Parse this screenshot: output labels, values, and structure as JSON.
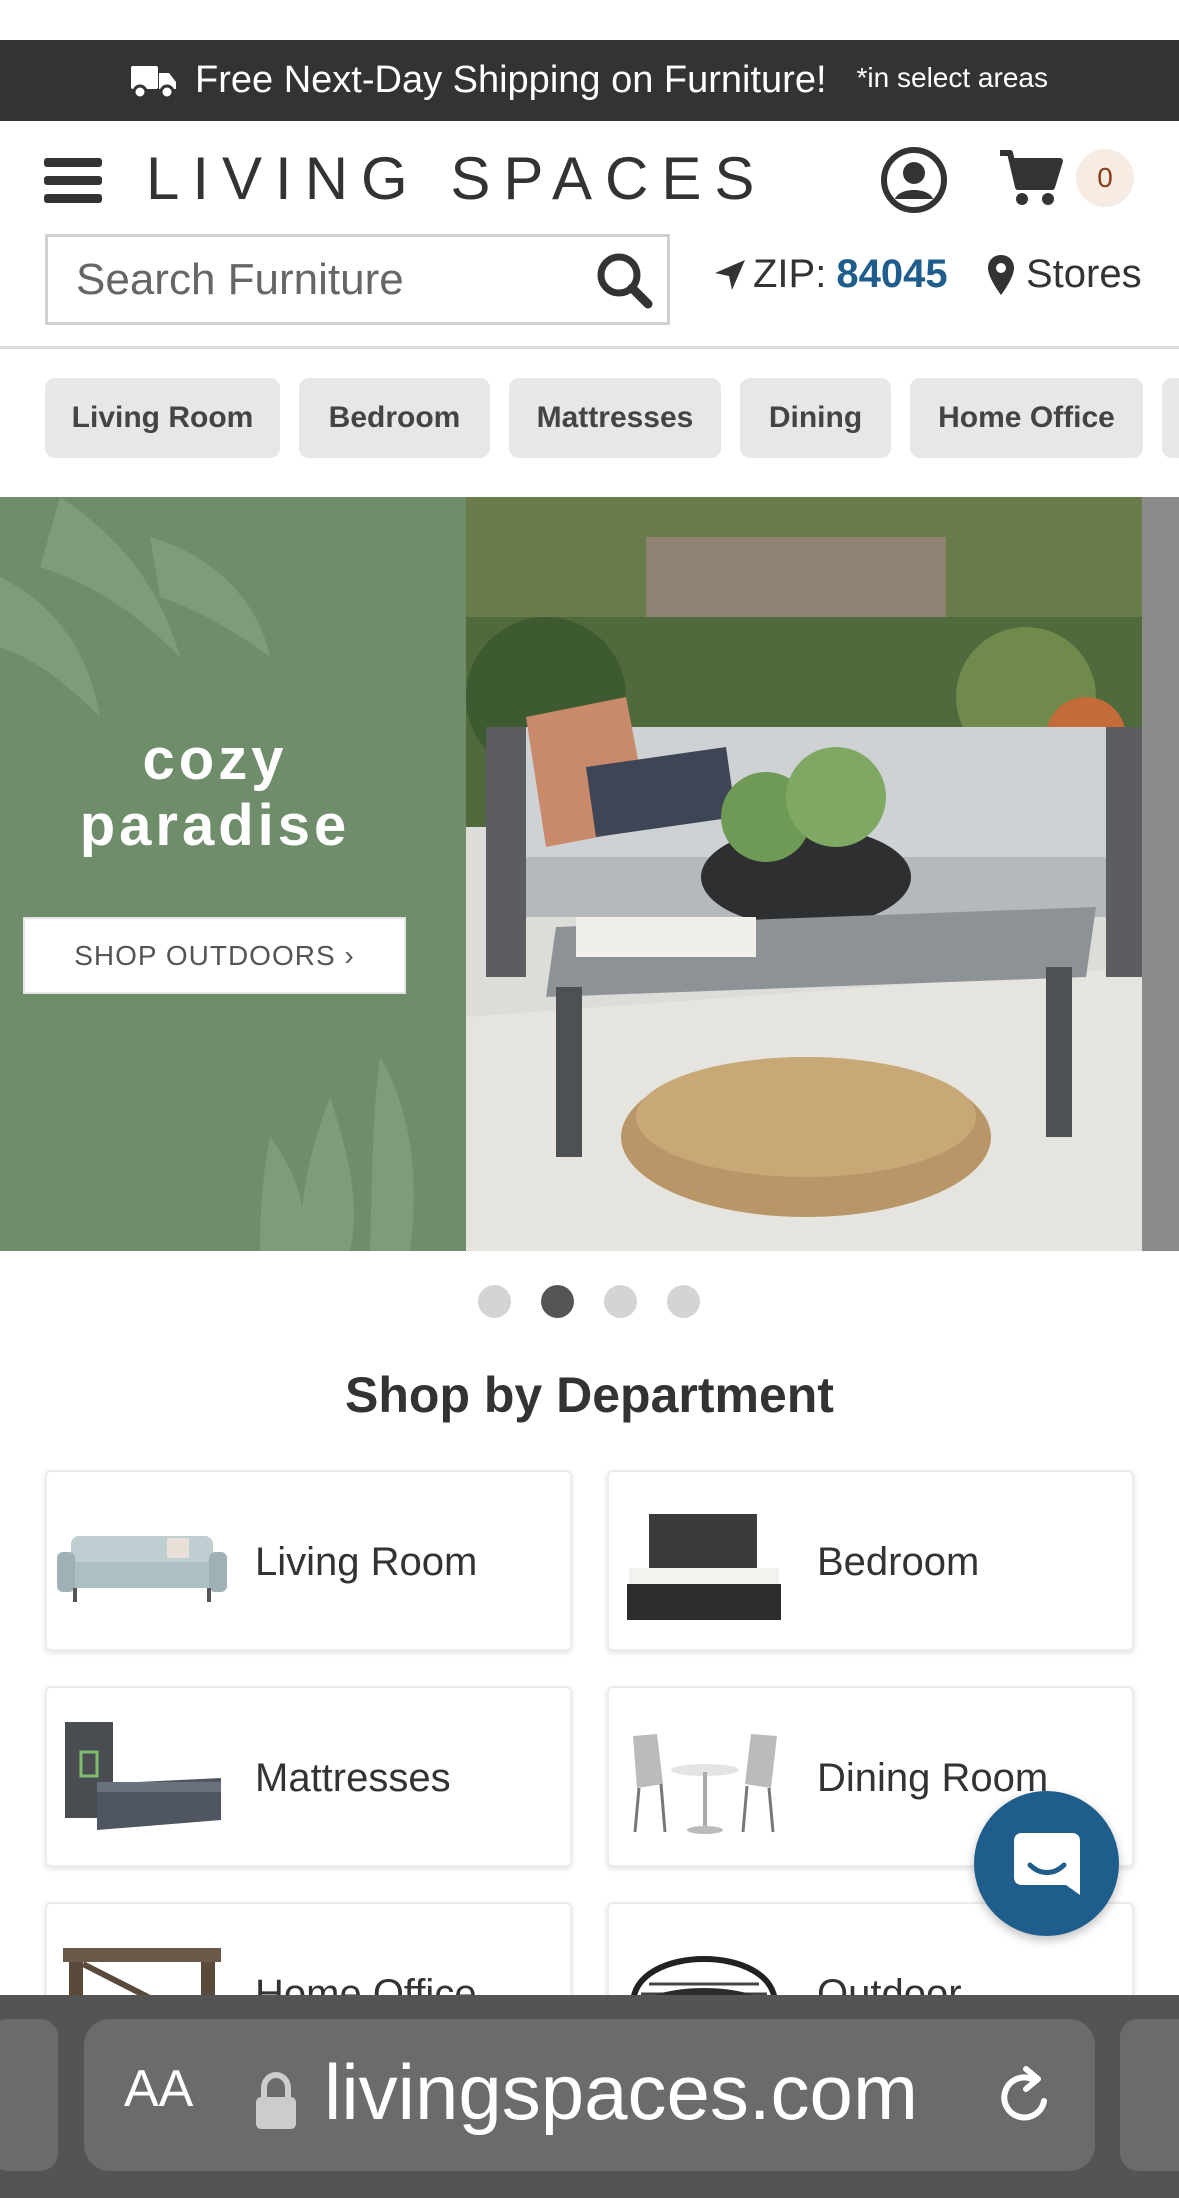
{
  "banner": {
    "main_text": "Free Next-Day Shipping on Furniture!",
    "note_text": "*in select areas"
  },
  "header": {
    "logo": "LIVING SPACES",
    "cart_count": "0",
    "search_placeholder": "Search Furniture",
    "zip_label": "ZIP:",
    "zip_code": "84045",
    "stores_label": "Stores"
  },
  "categories": [
    "Living Room",
    "Bedroom",
    "Mattresses",
    "Dining",
    "Home Office"
  ],
  "hero": {
    "title_line1": "cozy",
    "title_line2": "paradise",
    "cta_label": "SHOP OUTDOORS ›",
    "slide_count": 4,
    "active_slide": 2,
    "background_color": "#6f8c6b"
  },
  "departments": {
    "title": "Shop by Department",
    "items": [
      "Living Room",
      "Bedroom",
      "Mattresses",
      "Dining Room",
      "Home Office",
      "Outdoor"
    ]
  },
  "browser": {
    "aa_label": "AA",
    "url": "livingspaces.com"
  },
  "colors": {
    "accent": "#1f5e8c",
    "banner": "#333333",
    "chip": "#e7e7e7"
  }
}
